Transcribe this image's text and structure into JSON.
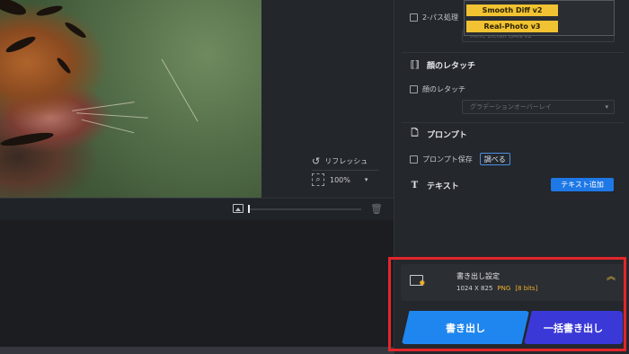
{
  "viewer": {
    "refresh_label": "リフレッシュ",
    "zoom_value": "100%"
  },
  "panel": {
    "two_pass_label": "2-パス処理",
    "model_options": [
      "Smooth Diff  v2",
      "Real-Photo  v3"
    ],
    "model_dropdown_value": "More-Detail GAN  v2",
    "face_retouch_title": "顔のレタッチ",
    "face_retouch_checkbox": "顔のレタッチ",
    "face_retouch_dropdown": "グラデーションオーバーレイ",
    "prompt_title": "プロンプト",
    "prompt_save_label": "プロンプト保存",
    "lookup_button": "調べる",
    "text_title": "テキスト",
    "add_text_button": "テキスト追加"
  },
  "export": {
    "title": "書き出し設定",
    "size": "1024 X 825",
    "format": "PNG",
    "bits": "[8 bits]",
    "export_button": "書き出し",
    "batch_export_button": "一括書き出し"
  },
  "colors": {
    "accent_blue": "#1f86f0",
    "batch_purple": "#3a39d8",
    "highlight_red": "#e3262b",
    "option_yellow": "#f1c232"
  }
}
